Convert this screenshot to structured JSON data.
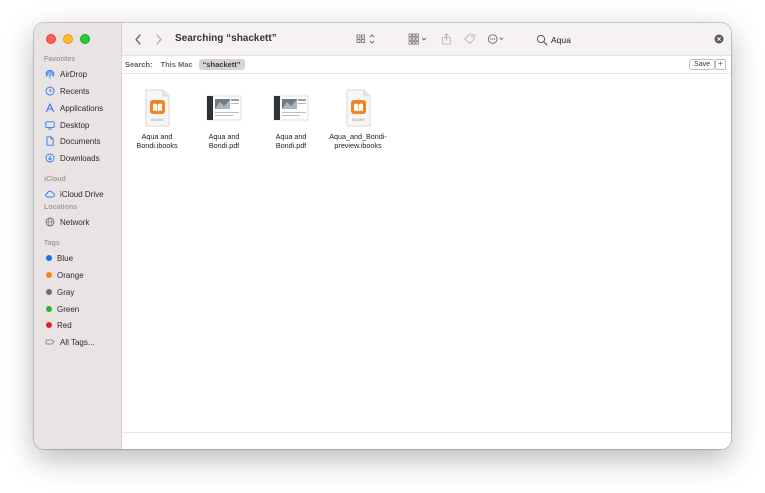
{
  "window": {
    "title": "Searching “shackett”"
  },
  "sidebar": {
    "sections": [
      {
        "header": "Favorites",
        "items": [
          {
            "label": "AirDrop",
            "icon": "airdrop-icon"
          },
          {
            "label": "Recents",
            "icon": "clock-icon"
          },
          {
            "label": "Applications",
            "icon": "applications-icon"
          },
          {
            "label": "Desktop",
            "icon": "desktop-icon"
          },
          {
            "label": "Documents",
            "icon": "document-icon"
          },
          {
            "label": "Downloads",
            "icon": "download-icon"
          }
        ]
      },
      {
        "header": "iCloud",
        "items": [
          {
            "label": "iCloud Drive",
            "icon": "cloud-icon"
          }
        ]
      },
      {
        "header": "Locations",
        "items": [
          {
            "label": "Network",
            "icon": "globe-icon"
          }
        ]
      },
      {
        "header": "Tags",
        "items": [
          {
            "label": "Blue",
            "color": "#1e6ff0"
          },
          {
            "label": "Orange",
            "color": "#f7821b"
          },
          {
            "label": "Gray",
            "color": "#6e6e6e"
          },
          {
            "label": "Green",
            "color": "#28b52b"
          },
          {
            "label": "Red",
            "color": "#e02020"
          },
          {
            "label": "All Tags...",
            "icon": "all-tags-icon"
          }
        ]
      }
    ],
    "accent_color": "#2f7bf5"
  },
  "search": {
    "value": "Aqua"
  },
  "scope": {
    "label": "Search:",
    "this_mac": "This Mac",
    "selected": "“shackett”",
    "save": "Save",
    "add": "+"
  },
  "files": [
    {
      "name_line1": "Aqua and",
      "name_line2": "Bondi.ibooks",
      "type": "ibooks",
      "badge": "BOOKS"
    },
    {
      "name_line1": "Aqua and",
      "name_line2": "Bondi.pdf",
      "type": "pdf"
    },
    {
      "name_line1": "Aqua and",
      "name_line2": "Bondi.pdf",
      "type": "pdf"
    },
    {
      "name_line1": "Aqua_and_Bondi-",
      "name_line2": "preview.ibooks",
      "type": "ibooks",
      "badge": "BOOKS"
    }
  ],
  "colors": {
    "books_orange": "#f5821f",
    "traffic_close": "#fd5f57",
    "traffic_min": "#febc2e",
    "traffic_max": "#28c840"
  }
}
